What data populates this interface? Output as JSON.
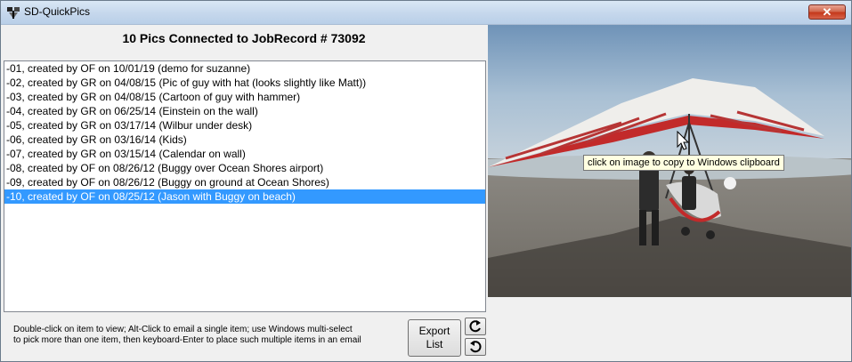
{
  "window": {
    "title": "SD-QuickPics",
    "close_glyph": "✕"
  },
  "header": {
    "title": "10 Pics Connected to JobRecord # 73092"
  },
  "list": {
    "items": [
      "-01, created by OF on 10/01/19 (demo for suzanne)",
      "-02, created by GR on 04/08/15 (Pic of guy with hat (looks slightly like Matt))",
      "-03, created by GR on 04/08/15 (Cartoon of guy with hammer)",
      "-04, created by GR on 06/25/14 (Einstein on the wall)",
      "-05, created by GR on 03/17/14 (Wilbur under desk)",
      "-06, created by GR on 03/16/14 (Kids)",
      "-07, created by GR on 03/15/14 (Calendar on wall)",
      "-08, created by OF on 08/26/12 (Buggy over Ocean Shores airport)",
      "-09, created by OF on 08/26/12 (Buggy on ground at Ocean Shores)",
      "-10, created by OF on 08/25/12 (Jason with Buggy on beach)"
    ],
    "selected_index": 9
  },
  "photo": {
    "tooltip": "click on image to copy to Windows clipboard"
  },
  "footer": {
    "help_line1": "Double-click on item to view; Alt-Click to email a single item; use Windows multi-select",
    "help_line2": "to pick more than one item, then keyboard-Enter to place such multiple items in an email",
    "export_line1": "Export",
    "export_line2": "List"
  },
  "icons": {
    "app": "app-icon",
    "rotate_cw": "rotate-clockwise-icon",
    "rotate_ccw": "rotate-counterclockwise-icon",
    "cursor": "mouse-pointer-icon"
  },
  "colors": {
    "selection": "#3399ff",
    "tooltip_bg": "#ffffe1",
    "close_button": "#c4391c"
  }
}
